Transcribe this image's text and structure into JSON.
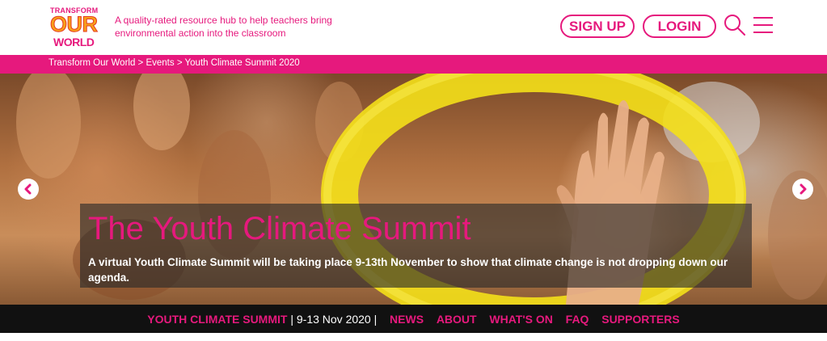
{
  "logo": {
    "line1": "TRANSFORM",
    "line2": "OUR",
    "line3": "WORLD"
  },
  "header": {
    "tagline": "A quality-rated resource hub to help teachers bring environmental action into the classroom",
    "signup_label": "SIGN UP",
    "login_label": "LOGIN",
    "icons": [
      "search-icon",
      "menu-icon"
    ]
  },
  "breadcrumb": {
    "items": [
      "Transform Our World",
      "Events",
      "Youth Climate Summit 2020"
    ],
    "separator": " > "
  },
  "hero": {
    "title": "The Youth Climate Summit",
    "description": "A virtual Youth Climate Summit will be taking place 9-13th November to show that climate change is not dropping down our agenda.",
    "icons": [
      "chevron-left-icon",
      "chevron-right-icon"
    ]
  },
  "subnav": {
    "event_name": "YOUTH CLIMATE SUMMIT",
    "divider": "|",
    "dates": "9-13 Nov 2020",
    "links": [
      "NEWS",
      "ABOUT",
      "WHAT'S ON",
      "FAQ",
      "SUPPORTERS"
    ]
  },
  "colors": {
    "brand_pink": "#e6197d",
    "logo_orange": "#f7a11a",
    "nav_bg": "#111111"
  }
}
